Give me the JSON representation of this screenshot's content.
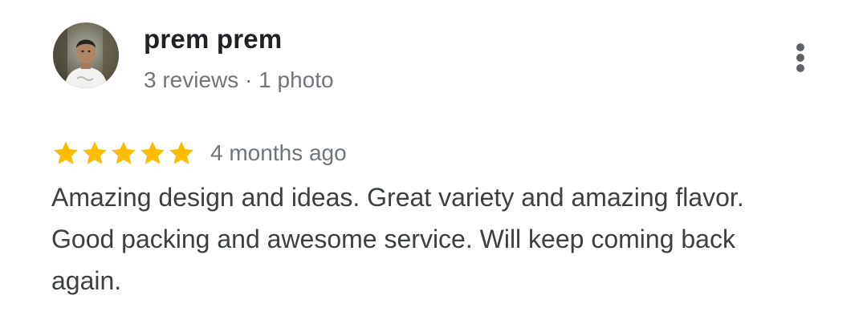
{
  "reviewer": {
    "name": "prem prem",
    "meta": "3 reviews · 1 photo"
  },
  "review": {
    "rating": 5,
    "rating_max": 5,
    "time": "4 months ago",
    "text": "Amazing design and ideas. Great variety and amazing flavor. Good packing and awesome service. Will keep coming back again."
  },
  "icons": {
    "star": "star-icon",
    "more": "more-vert-icon",
    "avatar": "profile-photo"
  },
  "colors": {
    "star": "#fbbc04",
    "name": "#202124",
    "meta": "#70757a",
    "text": "#3c4043"
  }
}
